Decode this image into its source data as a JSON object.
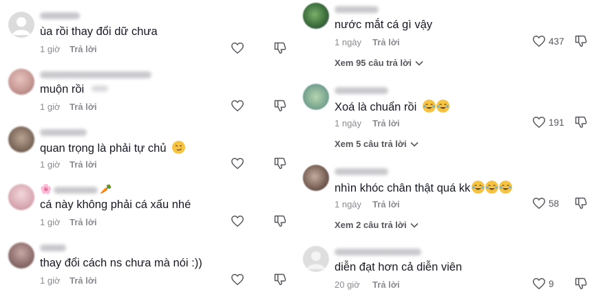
{
  "reply_label": "Trả lời",
  "left_comments": [
    {
      "text": "ùa rồi thay đổi dữ chưa",
      "time": "1 giờ"
    },
    {
      "text": "muộn rồi",
      "time": "1 giờ"
    },
    {
      "text": "quan trọng là phải tự chủ",
      "time": "1 giờ"
    },
    {
      "text": "cá này không phải cá xấu nhé",
      "time": "1 giờ"
    },
    {
      "text": "thay đổi cách ns chưa mà nói :))",
      "time": "1 giờ"
    }
  ],
  "right_comments": [
    {
      "text": "nước mắt cá gì vậy",
      "time": "1 ngày",
      "likes": "437",
      "view_replies": "Xem 95 câu trả lời"
    },
    {
      "text": "Xoá là chuẩn rồi",
      "time": "1 ngày",
      "likes": "191",
      "view_replies": "Xem 5 câu trả lời"
    },
    {
      "text": "nhìn khóc chân thật quá kk",
      "time": "1 ngày",
      "likes": "58",
      "view_replies": "Xem 2 câu trả lời"
    },
    {
      "text": "diễn đạt hơn cả diễn viên",
      "time": "20 giờ",
      "likes": "9"
    }
  ],
  "icons": {
    "like": "heart-outline-icon",
    "dislike": "thumbs-down-outline-icon",
    "expand": "chevron-down-icon",
    "default_avatar": "person-silhouette-icon"
  },
  "colors": {
    "text_primary": "#161823",
    "text_secondary": "#8a8b91",
    "emoji_yellow": "#f6c343"
  }
}
